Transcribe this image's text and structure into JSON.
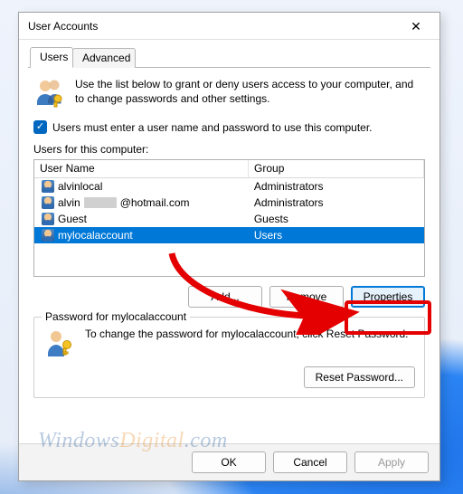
{
  "window": {
    "title": "User Accounts"
  },
  "tabs": {
    "users": "Users",
    "advanced": "Advanced"
  },
  "intro": "Use the list below to grant or deny users access to your computer, and to change passwords and other settings.",
  "checkbox": {
    "label": "Users must enter a user name and password to use this computer.",
    "checked": true
  },
  "list_label": "Users for this computer:",
  "columns": {
    "name": "User Name",
    "group": "Group"
  },
  "rows": [
    {
      "name": "alvinlocal",
      "group": "Administrators",
      "masked": false,
      "selected": false
    },
    {
      "name": "@hotmail.com",
      "prefix": "alvin",
      "group": "Administrators",
      "masked": true,
      "selected": false
    },
    {
      "name": "Guest",
      "group": "Guests",
      "masked": false,
      "selected": false
    },
    {
      "name": "mylocalaccount",
      "group": "Users",
      "masked": false,
      "selected": true
    }
  ],
  "buttons": {
    "add": "Add...",
    "remove": "Remove",
    "properties": "Properties"
  },
  "pwgroup": {
    "legend": "Password for mylocalaccount",
    "text": "To change the password for mylocalaccount, click Reset Password.",
    "reset": "Reset Password..."
  },
  "dlg": {
    "ok": "OK",
    "cancel": "Cancel",
    "apply": "Apply"
  },
  "watermark": {
    "a": "Windows",
    "b": "Digital",
    "c": ".com"
  }
}
